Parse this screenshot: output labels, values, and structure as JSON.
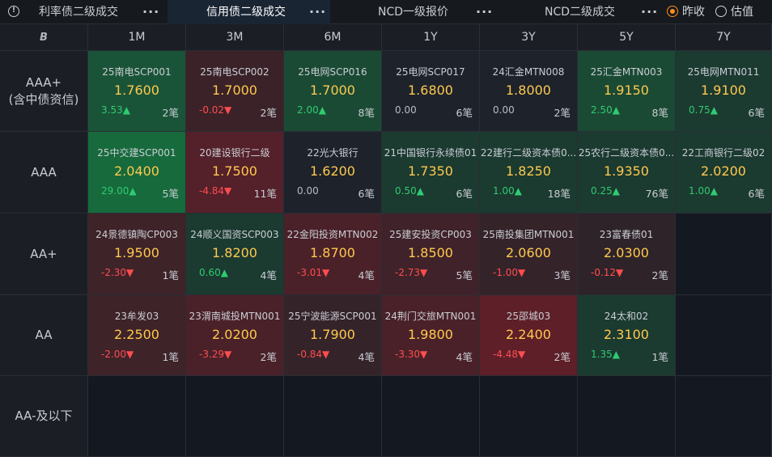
{
  "tabs": [
    {
      "label": "利率债二级成交",
      "active": false
    },
    {
      "label": "信用债二级成交",
      "active": true
    },
    {
      "label": "NCD一级报价",
      "active": false
    },
    {
      "label": "NCD二级成交",
      "active": false
    }
  ],
  "more_label": "···",
  "options": [
    {
      "label": "昨收",
      "checked": true
    },
    {
      "label": "估值",
      "checked": false
    }
  ],
  "corner": "B",
  "tenors": [
    "1M",
    "3M",
    "6M",
    "1Y",
    "3Y",
    "5Y",
    "7Y"
  ],
  "rows": [
    {
      "label": [
        "AAA+",
        "(含中债资信)"
      ],
      "cells": [
        {
          "name": "25南电SCP001",
          "rate": "1.7600",
          "change": "3.53▲",
          "dir": "up",
          "count": "2笔",
          "bg": "#1a5438"
        },
        {
          "name": "25南电SCP002",
          "rate": "1.7000",
          "change": "-0.02▼",
          "dir": "down",
          "count": "2笔",
          "bg": "#3a2228"
        },
        {
          "name": "25电网SCP016",
          "rate": "1.7000",
          "change": "2.00▲",
          "dir": "up",
          "count": "8笔",
          "bg": "#1a4a34"
        },
        {
          "name": "25电网SCP017",
          "rate": "1.6800",
          "change": "0.00",
          "dir": "flat",
          "count": "6笔",
          "bg": "#1d222b"
        },
        {
          "name": "24汇金MTN008",
          "rate": "1.8000",
          "change": "0.00",
          "dir": "flat",
          "count": "2笔",
          "bg": "#1d222b"
        },
        {
          "name": "25汇金MTN003",
          "rate": "1.9150",
          "change": "2.50▲",
          "dir": "up",
          "count": "8笔",
          "bg": "#1a4a34"
        },
        {
          "name": "25电网MTN011",
          "rate": "1.9100",
          "change": "0.75▲",
          "dir": "up",
          "count": "6笔",
          "bg": "#1b3a30"
        }
      ]
    },
    {
      "label": [
        "AAA"
      ],
      "cells": [
        {
          "name": "25中交建SCP001",
          "rate": "2.0400",
          "change": "29.00▲",
          "dir": "up",
          "count": "5笔",
          "bg": "#166a3c"
        },
        {
          "name": "20建设银行二级",
          "rate": "1.7500",
          "change": "-4.84▼",
          "dir": "down",
          "count": "11笔",
          "bg": "#54202a"
        },
        {
          "name": "22光大银行",
          "rate": "1.6200",
          "change": "0.00",
          "dir": "flat",
          "count": "6笔",
          "bg": "#1d222b"
        },
        {
          "name": "21中国银行永续债01",
          "rate": "1.7350",
          "change": "0.50▲",
          "dir": "up",
          "count": "6笔",
          "bg": "#1b3a30"
        },
        {
          "name": "22建行二级资本债0...",
          "rate": "1.8250",
          "change": "1.00▲",
          "dir": "up",
          "count": "18笔",
          "bg": "#1b3a30"
        },
        {
          "name": "25农行二级资本债0...",
          "rate": "1.9350",
          "change": "0.25▲",
          "dir": "up",
          "count": "76笔",
          "bg": "#1b3a30"
        },
        {
          "name": "22工商银行二级02",
          "rate": "2.0200",
          "change": "1.00▲",
          "dir": "up",
          "count": "6笔",
          "bg": "#1b3a30"
        }
      ]
    },
    {
      "label": [
        "AA+"
      ],
      "cells": [
        {
          "name": "24景德镇陶CP003",
          "rate": "1.9500",
          "change": "-2.30▼",
          "dir": "down",
          "count": "1笔",
          "bg": "#3e2329"
        },
        {
          "name": "24顺义国资SCP003",
          "rate": "1.8200",
          "change": "0.60▲",
          "dir": "up",
          "count": "4笔",
          "bg": "#1b3a30"
        },
        {
          "name": "22金阳投资MTN002",
          "rate": "1.8700",
          "change": "-3.01▼",
          "dir": "down",
          "count": "4笔",
          "bg": "#4a2129"
        },
        {
          "name": "25建安投资CP003",
          "rate": "1.8500",
          "change": "-2.73▼",
          "dir": "down",
          "count": "5笔",
          "bg": "#40222a"
        },
        {
          "name": "25南投集团MTN001",
          "rate": "2.0600",
          "change": "-1.00▼",
          "dir": "down",
          "count": "3笔",
          "bg": "#35232a"
        },
        {
          "name": "23富春债01",
          "rate": "2.0300",
          "change": "-0.12▼",
          "dir": "down",
          "count": "2笔",
          "bg": "#2e2329"
        },
        null
      ]
    },
    {
      "label": [
        "AA"
      ],
      "cells": [
        {
          "name": "23牟发03",
          "rate": "2.2500",
          "change": "-2.00▼",
          "dir": "down",
          "count": "1笔",
          "bg": "#3e2329"
        },
        {
          "name": "23渭南城投MTN001",
          "rate": "2.0200",
          "change": "-3.29▼",
          "dir": "down",
          "count": "2笔",
          "bg": "#4a2129"
        },
        {
          "name": "25宁波能源SCP001",
          "rate": "1.7900",
          "change": "-0.84▼",
          "dir": "down",
          "count": "4笔",
          "bg": "#35232a"
        },
        {
          "name": "24荆门交旅MTN001",
          "rate": "1.9800",
          "change": "-3.30▼",
          "dir": "down",
          "count": "4笔",
          "bg": "#4a2129"
        },
        {
          "name": "25邵城03",
          "rate": "2.2400",
          "change": "-4.48▼",
          "dir": "down",
          "count": "2笔",
          "bg": "#5e1f28"
        },
        {
          "name": "24太和02",
          "rate": "2.3100",
          "change": "1.35▲",
          "dir": "up",
          "count": "1笔",
          "bg": "#1b3a30"
        },
        null
      ]
    },
    {
      "label": [
        "AA-及以下"
      ],
      "cells": [
        null,
        null,
        null,
        null,
        null,
        null,
        null
      ]
    }
  ]
}
